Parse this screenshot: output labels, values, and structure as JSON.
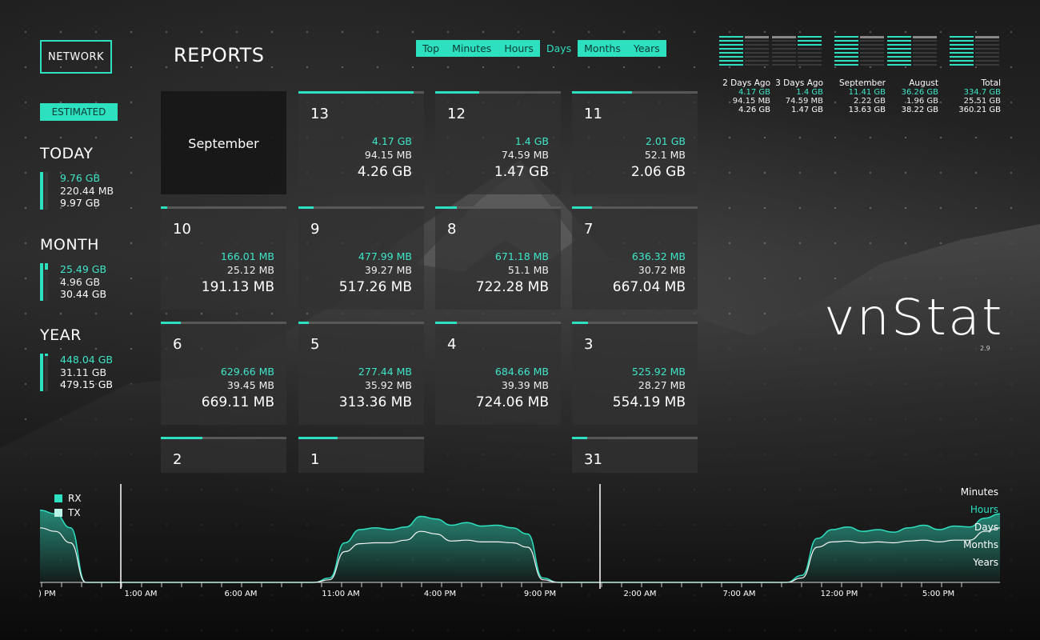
{
  "network_button": "NETWORK",
  "estimated_badge": "ESTIMATED",
  "summary": [
    {
      "title": "TODAY",
      "rx": "9.76 GB",
      "tx": "220.44 MB",
      "total": "9.97 GB"
    },
    {
      "title": "MONTH",
      "rx": "25.49 GB",
      "tx": "4.96 GB",
      "total": "30.44 GB"
    },
    {
      "title": "YEAR",
      "rx": "448.04 GB",
      "tx": "31.11 GB",
      "total": "479.15 GB"
    }
  ],
  "reports_title": "REPORTS",
  "range_tabs": [
    "Top",
    "Minutes",
    "Hours",
    "Days",
    "Months",
    "Years"
  ],
  "active_tab": "Days",
  "month_label": "September",
  "days": [
    {
      "day": "13",
      "rx": "4.17 GB",
      "tx": "94.15 MB",
      "total": "4.26 GB",
      "fill": 0.92
    },
    {
      "day": "12",
      "rx": "1.4 GB",
      "tx": "74.59 MB",
      "total": "1.47 GB",
      "fill": 0.35
    },
    {
      "day": "11",
      "rx": "2.01 GB",
      "tx": "52.1 MB",
      "total": "2.06 GB",
      "fill": 0.48
    },
    {
      "day": "10",
      "rx": "166.01 MB",
      "tx": "25.12 MB",
      "total": "191.13 MB",
      "fill": 0.05
    },
    {
      "day": "9",
      "rx": "477.99 MB",
      "tx": "39.27 MB",
      "total": "517.26 MB",
      "fill": 0.12
    },
    {
      "day": "8",
      "rx": "671.18 MB",
      "tx": "51.1 MB",
      "total": "722.28 MB",
      "fill": 0.17
    },
    {
      "day": "7",
      "rx": "636.32 MB",
      "tx": "30.72 MB",
      "total": "667.04 MB",
      "fill": 0.16
    },
    {
      "day": "6",
      "rx": "629.66 MB",
      "tx": "39.45 MB",
      "total": "669.11 MB",
      "fill": 0.16
    },
    {
      "day": "5",
      "rx": "277.44 MB",
      "tx": "35.92 MB",
      "total": "313.36 MB",
      "fill": 0.08
    },
    {
      "day": "4",
      "rx": "684.66 MB",
      "tx": "39.39 MB",
      "total": "724.06 MB",
      "fill": 0.17
    },
    {
      "day": "3",
      "rx": "525.92 MB",
      "tx": "28.27 MB",
      "total": "554.19 MB",
      "fill": 0.13
    },
    {
      "day": "2",
      "fill": 0.33
    },
    {
      "day": "1",
      "fill": 0.31
    },
    {
      "day": "31",
      "fill": 0.12
    }
  ],
  "stats": [
    {
      "label": "2 Days Ago",
      "rx": "4.17 GB",
      "tx": "94.15 MB",
      "total": "4.26 GB"
    },
    {
      "label": "3 Days Ago",
      "rx": "1.4 GB",
      "tx": "74.59 MB",
      "total": "1.47 GB"
    },
    {
      "label": "September",
      "rx": "11.41 GB",
      "tx": "2.22 GB",
      "total": "13.63 GB"
    },
    {
      "label": "August",
      "rx": "36.26 GB",
      "tx": "1.96 GB",
      "total": "38.22 GB"
    },
    {
      "label": "Total",
      "rx": "334.7 GB",
      "tx": "25.51 GB",
      "total": "360.21 GB"
    }
  ],
  "logo": {
    "name": "vnStat",
    "version": "2.9"
  },
  "legend": {
    "rx": "RX",
    "tx": "TX"
  },
  "granularity": [
    "Minutes",
    "Hours",
    "Days",
    "Months",
    "Years"
  ],
  "active_granularity": "Hours",
  "colors": {
    "accent": "#2de0c0",
    "rx": "#3ee6c7",
    "tx": "#eeeeee"
  },
  "chart_data": {
    "type": "area",
    "x_tick_labels": [
      ") PM",
      "1:00 AM",
      "6:00 AM",
      "11:00 AM",
      "4:00 PM",
      "9:00 PM",
      "2:00 AM",
      "7:00 AM",
      "12:00 PM",
      "5:00 PM"
    ],
    "series": [
      {
        "name": "RX",
        "values": [
          0.82,
          0.78,
          0.62,
          0,
          0,
          0,
          0,
          0,
          0,
          0,
          0,
          0,
          0,
          0,
          0,
          0,
          0,
          0,
          0,
          0.05,
          0.45,
          0.6,
          0.62,
          0.6,
          0.63,
          0.75,
          0.72,
          0.65,
          0.68,
          0.64,
          0.65,
          0.62,
          0.55,
          0.05,
          0,
          0,
          0,
          0,
          0,
          0,
          0,
          0,
          0,
          0,
          0,
          0,
          0,
          0,
          0,
          0,
          0.08,
          0.5,
          0.6,
          0.63,
          0.58,
          0.6,
          0.57,
          0.62,
          0.65,
          0.6,
          0.64,
          0.63,
          0.73,
          0.78
        ]
      },
      {
        "name": "TX",
        "values": [
          0.62,
          0.58,
          0.45,
          0,
          0,
          0,
          0,
          0,
          0,
          0,
          0,
          0,
          0,
          0,
          0,
          0,
          0,
          0,
          0,
          0.03,
          0.35,
          0.44,
          0.45,
          0.45,
          0.48,
          0.58,
          0.55,
          0.47,
          0.48,
          0.46,
          0.46,
          0.45,
          0.4,
          0.03,
          0,
          0,
          0,
          0,
          0,
          0,
          0,
          0,
          0,
          0,
          0,
          0,
          0,
          0,
          0,
          0,
          0.05,
          0.4,
          0.46,
          0.47,
          0.45,
          0.46,
          0.45,
          0.47,
          0.48,
          0.46,
          0.48,
          0.48,
          0.58,
          0.62
        ]
      }
    ]
  }
}
